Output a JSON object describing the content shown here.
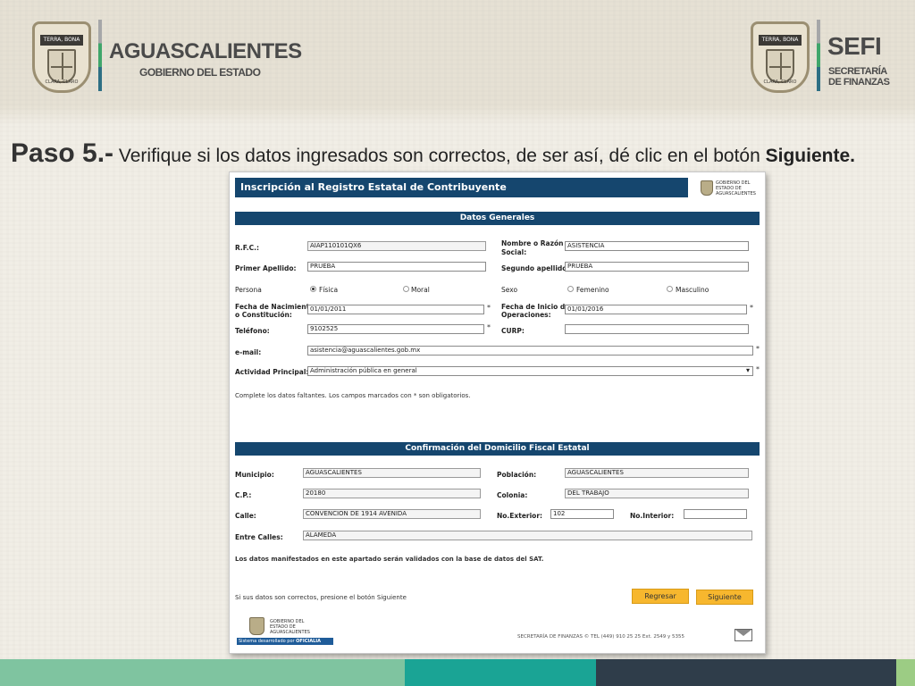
{
  "slide": {
    "left_logo": {
      "seal_band": "TERRA, BONA",
      "seal_foot": "CLARA, CLARO",
      "title": "AGUASCALIENTES",
      "subtitle": "GOBIERNO DEL ESTADO"
    },
    "right_logo": {
      "seal_band": "TERRA, BONA",
      "seal_foot": "CLARA, CLARO",
      "title": "SEFI",
      "line1": "SECRETARÍA",
      "line2": "DE FINANZAS"
    },
    "step": {
      "lead": "Paso 5.-",
      "text": " Verifique si los datos ingresados son correctos, de ser así, dé clic en el botón ",
      "button_name": "Siguiente."
    },
    "colors": {
      "header_navy": "#15466e",
      "button_orange": "#f7b72e",
      "stripe_light_green": "#7fc4a0",
      "stripe_teal": "#1aa495",
      "stripe_dark": "#2f3d4a",
      "stripe_lime": "#9ccc84"
    }
  },
  "form": {
    "title": "Inscripción al Registro Estatal de Contribuyente",
    "header_logo": {
      "line1": "GOBIERNO DEL",
      "line2": "ESTADO DE",
      "line3": "AGUASCALIENTES"
    },
    "general": {
      "section_title": "Datos Generales",
      "rfc": {
        "label": "R.F.C.:",
        "value": "AIAP110101QX6"
      },
      "razon_social": {
        "label_line1": "Nombre o Razón",
        "label_line2": "Social:",
        "value": "ASISTENCIA"
      },
      "primer_apellido": {
        "label": "Primer Apellido:",
        "value": "PRUEBA"
      },
      "segundo_apellido": {
        "label": "Segundo apellido:",
        "value": "PRUEBA"
      },
      "persona": {
        "label": "Persona",
        "options": [
          "Física",
          "Moral"
        ],
        "selected": "Física"
      },
      "sexo": {
        "label": "Sexo",
        "options": [
          "Femenino",
          "Masculino"
        ]
      },
      "fecha_nacimiento": {
        "label_line1": "Fecha de Nacimiento",
        "label_line2": "o Constitución:",
        "value": "01/01/2011"
      },
      "fecha_inicio": {
        "label_line1": "Fecha de Inicio de",
        "label_line2": "Operaciones:",
        "value": "01/01/2016"
      },
      "telefono": {
        "label": "Teléfono:",
        "value": "9102525"
      },
      "curp": {
        "label": "CURP:",
        "value": ""
      },
      "email": {
        "label": "e-mail:",
        "value": "asistencia@aguascalientes.gob.mx"
      },
      "actividad": {
        "label": "Actividad Principal:",
        "value": "Administración pública en general"
      },
      "required_mark": "*",
      "note": "Complete los datos faltantes. Los campos marcados con * son obligatorios."
    },
    "domicilio": {
      "section_title": "Confirmación del Domicilio Fiscal Estatal",
      "municipio": {
        "label": "Municipio:",
        "value": "AGUASCALIENTES"
      },
      "poblacion": {
        "label": "Población:",
        "value": "AGUASCALIENTES"
      },
      "cp": {
        "label": "C.P.:",
        "value": "20180"
      },
      "colonia": {
        "label": "Colonia:",
        "value": "DEL TRABAJO"
      },
      "calle": {
        "label": "Calle:",
        "value": "CONVENCION DE 1914 AVENIDA"
      },
      "no_exterior": {
        "label": "No.Exterior:",
        "value": "102"
      },
      "no_interior": {
        "label": "No.Interior:",
        "value": ""
      },
      "entre_calles": {
        "label": "Entre Calles:",
        "value": "ALAMEDA"
      },
      "note": "Los datos manifestados en este apartado serán validados con la base de datos del SAT."
    },
    "confirm_note": "Si sus datos son correctos, presione el botón Siguiente",
    "buttons": {
      "back": "Regresar",
      "next": "Siguiente"
    },
    "footer": {
      "logo_line1": "GOBIERNO DEL",
      "logo_line2": "ESTADO DE",
      "logo_line3": "AGUASCALIENTES",
      "dev_prefix": "Sistema desarrollado por",
      "dev_org": "OFICIALIA MAYOR",
      "contact": "SECRETARÍA DE FINANZAS ©   TEL (449) 910 25 25   Ext. 2549 y 5355"
    }
  }
}
